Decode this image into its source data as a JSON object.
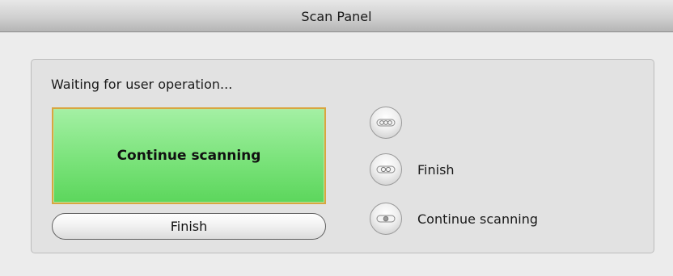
{
  "window": {
    "title": "Scan Panel"
  },
  "panel": {
    "status_text": "Waiting for user operation...",
    "continue_button_label": "Continue scanning",
    "finish_button_label": "Finish"
  },
  "options": [
    {
      "label": "",
      "icon": "scanner-sensor-icon"
    },
    {
      "label": "Finish",
      "icon": "scanner-sensor-icon"
    },
    {
      "label": "Continue scanning",
      "icon": "scanner-sensor-icon"
    }
  ],
  "colors": {
    "continue_button_fill": "#7ee47e",
    "continue_button_border": "#d8a640",
    "panel_background": "#e2e2e2",
    "window_background": "#ececec"
  }
}
